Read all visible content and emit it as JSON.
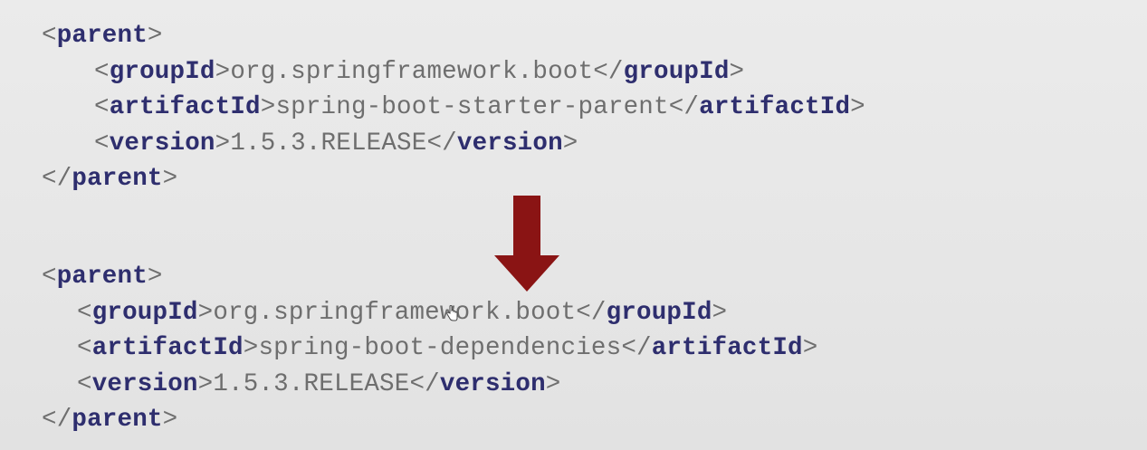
{
  "top_block": {
    "parent_tag": "parent",
    "group_tag": "groupId",
    "group_value": "org.springframework.boot",
    "artifact_tag": "artifactId",
    "artifact_value": "spring-boot-starter-parent",
    "version_tag": "version",
    "version_value": "1.5.3.RELEASE"
  },
  "bottom_block": {
    "parent_tag": "parent",
    "group_tag": "groupId",
    "group_value": "org.springframework.boot",
    "artifact_tag": "artifactId",
    "artifact_value": "spring-boot-dependencies",
    "version_tag": "version",
    "version_value": "1.5.3.RELEASE"
  },
  "arrow": {
    "icon": "arrow-down-icon",
    "color": "#8a1414"
  },
  "colors": {
    "tag": "#2e2e6e",
    "text": "#6e6e6e",
    "background": "#e8e8e8"
  }
}
